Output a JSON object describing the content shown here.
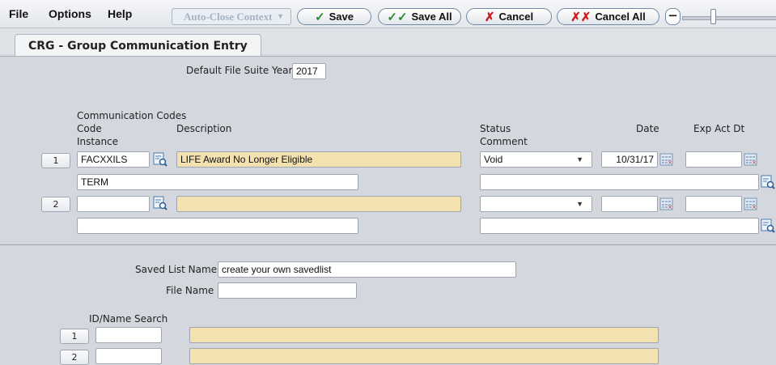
{
  "menu": {
    "file": "File",
    "options": "Options",
    "help": "Help"
  },
  "toolbar": {
    "context_label": "Auto-Close Context",
    "save_label": "Save",
    "save_all_label": "Save All",
    "cancel_label": "Cancel",
    "cancel_all_label": "Cancel All",
    "minus_label": "−"
  },
  "tab": {
    "label": "CRG - Group Communication Entry"
  },
  "form": {
    "default_year_label": "Default File Suite Year",
    "default_year_value": "2017",
    "section_title": "Communication Codes",
    "col_code": "Code",
    "col_instance": "Instance",
    "col_description": "Description",
    "col_status": "Status",
    "col_comment": "Comment",
    "col_date": "Date",
    "col_exp_act_dt": "Exp Act Dt",
    "rows": [
      {
        "num": "1",
        "code": "FACXXILS",
        "description": "LIFE Award No Longer Eligible",
        "instance": "TERM",
        "status": "Void",
        "date": "10/31/17",
        "exp_act_dt": "",
        "comment": ""
      },
      {
        "num": "2",
        "code": "",
        "description": "",
        "instance": "",
        "status": "",
        "date": "",
        "exp_act_dt": "",
        "comment": ""
      }
    ],
    "saved_list_label": "Saved List Name",
    "saved_list_value": "create your own savedlist",
    "file_name_label": "File Name",
    "file_name_value": "",
    "id_search_label": "ID/Name Search",
    "id_rows": [
      {
        "num": "1",
        "id": "",
        "name": ""
      },
      {
        "num": "2",
        "id": "",
        "name": ""
      }
    ]
  },
  "colors": {
    "tan_field": "#f3e2b0",
    "panel_bg": "#d4d8de",
    "check_green": "#2e8b2e",
    "cross_red": "#cc1d1d"
  },
  "icons": [
    "search-lookup-icon",
    "calendar-icon",
    "check-icon",
    "double-check-icon",
    "cross-icon",
    "double-cross-icon",
    "dropdown-caret-icon"
  ]
}
